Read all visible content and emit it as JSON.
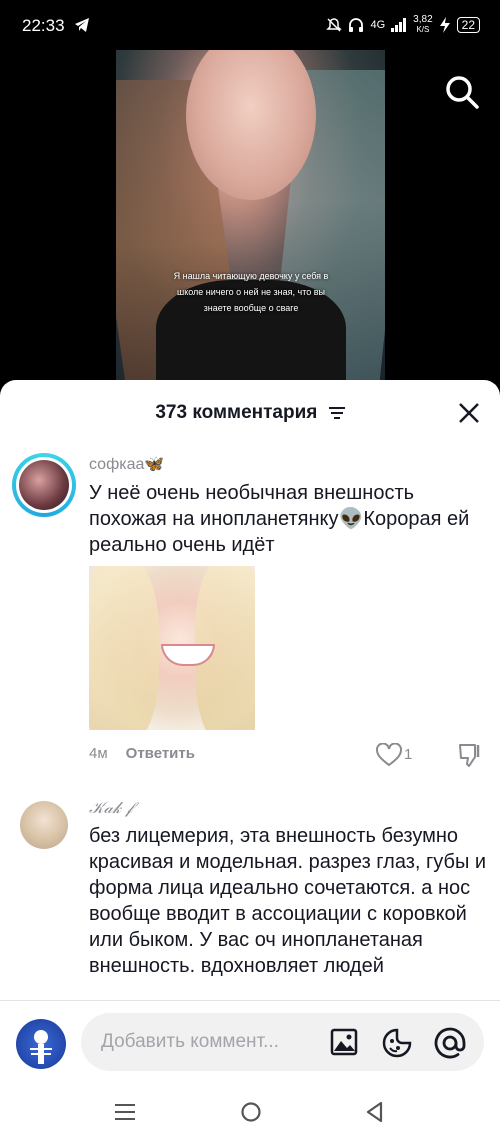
{
  "status": {
    "time": "22:33",
    "network": "4G",
    "speed_value": "3,82",
    "speed_unit": "K/S",
    "battery": "22"
  },
  "video": {
    "caption": "Я нашла читающую девочку у себя в школе ничего о ней не зная, что вы знаете вообще о сваге"
  },
  "comments_header": {
    "title": "373 комментария"
  },
  "comments": [
    {
      "username": "софкаа🦋",
      "text": "У неё очень необычная внешность похожая на инопланетянку👽Корорая ей реально очень идёт",
      "time": "4м",
      "reply_label": "Ответить",
      "likes": "1"
    },
    {
      "username": "𝒦𝒶𝓀 𝒻",
      "text": "без лицемерия, эта внешность безумно красивая и модельная. разрез глаз, губы и форма лица идеально сочетаются. а нос вообще вводит в ассоциации с коровкой или быком. У вас оч инопланетаная внешность. вдохновляет людей"
    }
  ],
  "composer": {
    "placeholder": "Добавить коммент..."
  },
  "colors": {
    "text": "#161823",
    "secondary": "#8a8b91",
    "avatar_ring": "#3fd7e8"
  },
  "icons": [
    "telegram-icon",
    "search-icon",
    "filter-icon",
    "close-icon",
    "heart-icon",
    "dislike-icon",
    "image-icon",
    "emoji-icon",
    "mention-icon",
    "menu-icon",
    "home-icon",
    "back-icon"
  ]
}
